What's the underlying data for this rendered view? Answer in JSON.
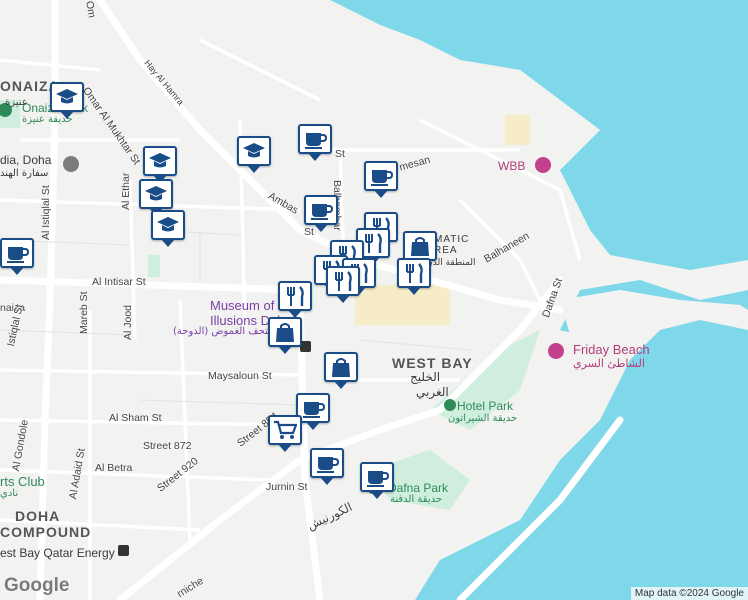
{
  "map": {
    "colors": {
      "water": "#7fd7ea",
      "land": "#f2f2f0",
      "road": "#ffffff",
      "park": "#cfeedd",
      "pin_border": "#1a4c87",
      "poi_pink": "#c2408c"
    },
    "areas": [
      {
        "text": "ONAIZA"
      },
      {
        "text": "عنيزة"
      },
      {
        "text": "WEST BAY"
      },
      {
        "text": "الخليج"
      },
      {
        "text": "الغربي"
      },
      {
        "text": "DOHA"
      },
      {
        "text": "COMPOUND"
      }
    ],
    "roads": [
      {
        "text": "Omar Al Mukhtar St"
      },
      {
        "text": "Hay Al Hamra"
      },
      {
        "text": "Al Intisar St"
      },
      {
        "text": "Al Istiqlal St"
      },
      {
        "text": "Al Ethar"
      },
      {
        "text": "Mareb St"
      },
      {
        "text": "Al Jood"
      },
      {
        "text": "Maysaloun St"
      },
      {
        "text": "Al Sham St"
      },
      {
        "text": "Street 872"
      },
      {
        "text": "Street 920"
      },
      {
        "text": "Street 854"
      },
      {
        "text": "Al Gondole"
      },
      {
        "text": "Al Adaid St"
      },
      {
        "text": "Al Betra"
      },
      {
        "text": "Jurnin St"
      },
      {
        "text": "Dafna St"
      },
      {
        "text": "Balhaneen"
      },
      {
        "text": "Balhambar"
      },
      {
        "text": "Ambas"
      },
      {
        "text": "St"
      },
      {
        "text": "St"
      },
      {
        "text": "mesan"
      },
      {
        "text": "naiza"
      },
      {
        "text": "Istiqlal St"
      },
      {
        "text": "rniche"
      },
      {
        "text": "الكورنيش"
      },
      {
        "text": "Om"
      }
    ],
    "places": [
      {
        "text": "Onaiza Park"
      },
      {
        "text": "حديقة عنيزة"
      },
      {
        "text": "dia, Doha"
      },
      {
        "text": "سفارة الهند"
      },
      {
        "text": "WBB"
      },
      {
        "text": "Friday Beach"
      },
      {
        "text": "الشاطئ السري"
      },
      {
        "text": "Hotel Park"
      },
      {
        "text": "حديقة الشيراتون"
      },
      {
        "text": "Dafna Park"
      },
      {
        "text": "حديقة الدفنة"
      },
      {
        "text": "Museum of"
      },
      {
        "text": "Illusions Doha"
      },
      {
        "text": "متحف الغموض (الدوحة)"
      },
      {
        "text": "MATIC"
      },
      {
        "text": "REA"
      },
      {
        "text": "المنطقة الدبلوماسية"
      },
      {
        "text": "rts Club"
      },
      {
        "text": "نادي"
      },
      {
        "text": "est Bay Qatar Energy"
      }
    ],
    "pins": [
      {
        "name": "education-icon"
      },
      {
        "name": "education-icon"
      },
      {
        "name": "education-icon"
      },
      {
        "name": "education-icon"
      },
      {
        "name": "education-icon"
      },
      {
        "name": "cafe-icon"
      },
      {
        "name": "cafe-icon"
      },
      {
        "name": "cafe-icon"
      },
      {
        "name": "cafe-icon"
      },
      {
        "name": "cafe-icon"
      },
      {
        "name": "cafe-icon"
      },
      {
        "name": "cafe-icon"
      },
      {
        "name": "shopping-bag-icon"
      },
      {
        "name": "shopping-bag-icon"
      },
      {
        "name": "shopping-bag-icon"
      },
      {
        "name": "shopping-cart-icon"
      },
      {
        "name": "restaurant-icon"
      },
      {
        "name": "restaurant-icon"
      },
      {
        "name": "restaurant-icon"
      },
      {
        "name": "restaurant-icon"
      },
      {
        "name": "restaurant-icon"
      },
      {
        "name": "restaurant-icon"
      },
      {
        "name": "restaurant-icon"
      },
      {
        "name": "restaurant-icon"
      }
    ],
    "logo": "Google",
    "attribution": "Map data ©2024 Google"
  }
}
